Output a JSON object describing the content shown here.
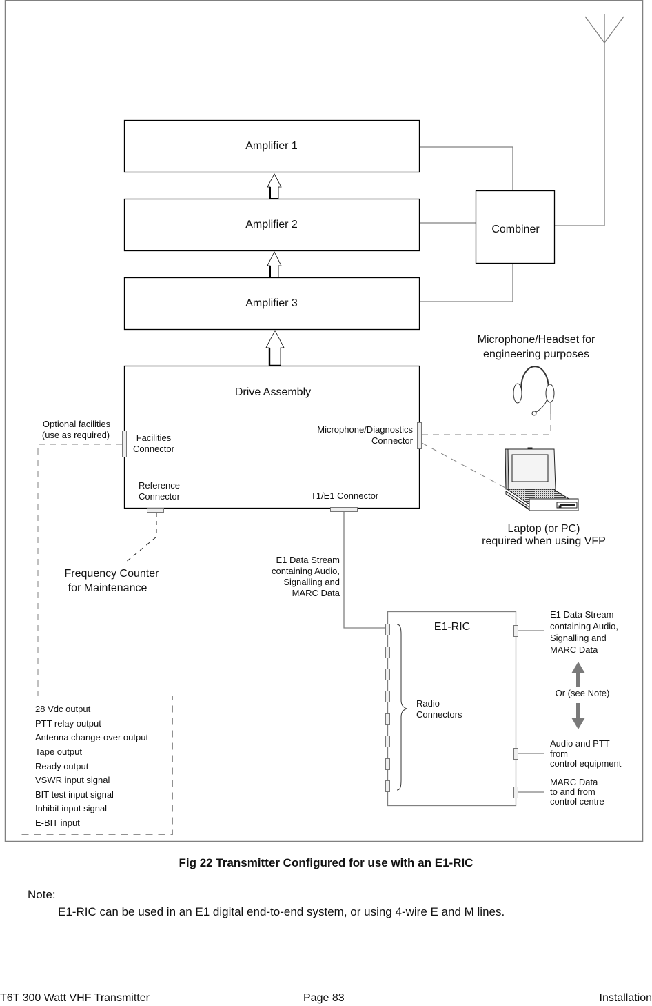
{
  "diagram": {
    "blocks": {
      "amplifier_1": "Amplifier 1",
      "amplifier_2": "Amplifier 2",
      "amplifier_3": "Amplifier 3",
      "combiner": "Combiner",
      "drive_assembly": "Drive Assembly",
      "e1_ric": "E1-RIC"
    },
    "drive_connectors": {
      "facilities": [
        "Facilities",
        "Connector"
      ],
      "microphone_diagnostics": [
        "Microphone/Diagnostics",
        "Connector"
      ],
      "reference": [
        "Reference",
        "Connector"
      ],
      "t1e1": "T1/E1 Connector"
    },
    "labels": {
      "optional_facilities": [
        "Optional facilities",
        "(use as required)"
      ],
      "headset": [
        "Microphone/Headset for",
        "engineering purposes"
      ],
      "laptop": [
        "Laptop (or PC)",
        "required when using VFP"
      ],
      "frequency_counter": [
        "Frequency Counter",
        "for Maintenance"
      ],
      "e1_stream_left": [
        "E1 Data Stream",
        "containing Audio,",
        "Signalling and",
        "MARC Data"
      ],
      "e1_stream_right": [
        "E1 Data Stream",
        "containing Audio,",
        "Signalling and",
        "MARC Data"
      ],
      "or_see_note": "Or (see Note)",
      "audio_ptt": [
        "Audio and PTT",
        "from",
        "control equipment"
      ],
      "marc_data": [
        "MARC Data",
        "to and from",
        "control centre"
      ],
      "radio_connectors": [
        "Radio",
        "Connectors"
      ]
    },
    "facilities_list": [
      "28 Vdc output",
      "PTT relay output",
      "Antenna change-over output",
      "Tape output",
      "Ready output",
      "VSWR input signal",
      "BIT test input signal",
      "Inhibit input signal",
      "E-BIT input"
    ],
    "icons": [
      "antenna-icon",
      "headset-icon",
      "laptop-icon",
      "signal-flow-arrow-icon"
    ],
    "colors": {
      "block_stroke": "#000000",
      "wire": "#808080",
      "connector_fill": "#eeeeee",
      "or_arrow": "#7a7a7a"
    }
  },
  "caption": "Fig 22  Transmitter Configured for use with an E1-RIC",
  "note": {
    "label": "Note:",
    "text": "E1-RIC can be used in an E1 digital end-to-end system, or using 4-wire E and M lines."
  },
  "footer": {
    "left": "T6T 300 Watt VHF Transmitter",
    "center": "Page 83",
    "right": "Installation"
  }
}
